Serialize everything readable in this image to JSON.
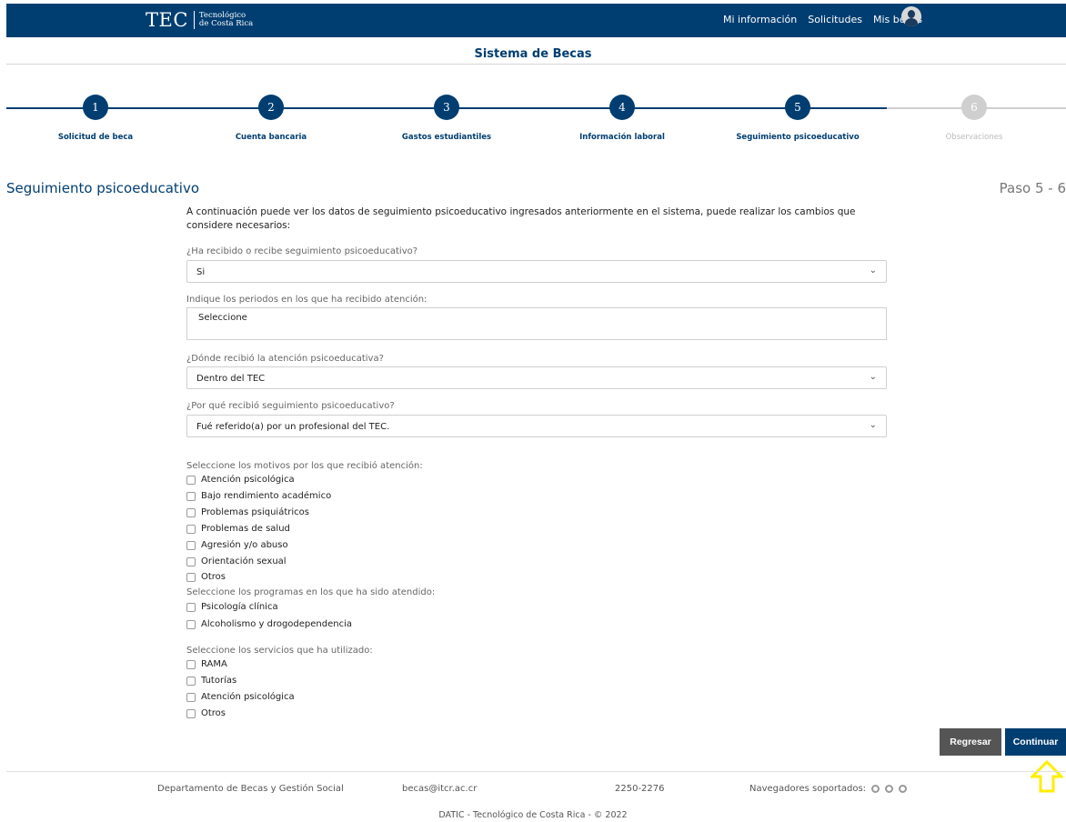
{
  "header": {
    "logo_main": "TEC",
    "logo_sub_1": "Tecnológico",
    "logo_sub_2": "de Costa Rica",
    "nav": [
      "Mi información",
      "Solicitudes",
      "Mis becas"
    ]
  },
  "system_title": "Sistema de Becas",
  "stepper": [
    {
      "num": "1",
      "label": "Solicitud de beca",
      "active": true
    },
    {
      "num": "2",
      "label": "Cuenta bancaria",
      "active": true
    },
    {
      "num": "3",
      "label": "Gastos estudiantiles",
      "active": true
    },
    {
      "num": "4",
      "label": "Información laboral",
      "active": true
    },
    {
      "num": "5",
      "label": "Seguimiento psicoeducativo",
      "active": true
    },
    {
      "num": "6",
      "label": "Observaciones",
      "active": false
    }
  ],
  "section_title": "Seguimiento psicoeducativo",
  "step_indicator": "Paso 5 - 6",
  "intro": "A continuación puede ver los datos de seguimiento psicoeducativo ingresados anteriormente en el sistema, puede realizar los cambios que considere necesarios:",
  "form": {
    "q1": {
      "label": "¿Ha recibido o recibe seguimiento psicoeducativo?",
      "value": "Si"
    },
    "q2": {
      "label": "Indique los periodos en los que ha recibido atención:",
      "placeholder": "Seleccione"
    },
    "q3": {
      "label": "¿Dónde recibió la atención psicoeducativa?",
      "value": "Dentro del TEC"
    },
    "q4": {
      "label": "¿Por qué recibió seguimiento psicoeducativo?",
      "value": "Fué referido(a) por un profesional del TEC."
    },
    "motivos": {
      "label": "Seleccione los motivos por los que recibió atención:",
      "options": [
        "Atención psicológica",
        "Bajo rendimiento académico",
        "Problemas psiquiátricos",
        "Problemas de salud",
        "Agresión y/o abuso",
        "Orientación sexual",
        "Otros"
      ]
    },
    "programas": {
      "label": "Seleccione los programas en los que ha sido atendido:",
      "options": [
        "Psicología clínica",
        "Alcoholismo y drogodependencia"
      ]
    },
    "servicios": {
      "label": "Seleccione los servicios que ha utilizado:",
      "options": [
        "RAMA",
        "Tutorías",
        "Atención psicológica",
        "Otros"
      ]
    }
  },
  "buttons": {
    "back": "Regresar",
    "next": "Continuar"
  },
  "footer": {
    "dept": "Departamento de Becas y Gestión Social",
    "email": "becas@itcr.ac.cr",
    "phone": "2250-2276",
    "browsers": "Navegadores soportados:",
    "copyright": "DATIC - Tecnológico de Costa Rica - © 2022"
  },
  "colors": {
    "primary": "#003e71",
    "secondary": "#555555",
    "disabled": "#cfcfcf",
    "highlight": "#ffee00"
  }
}
